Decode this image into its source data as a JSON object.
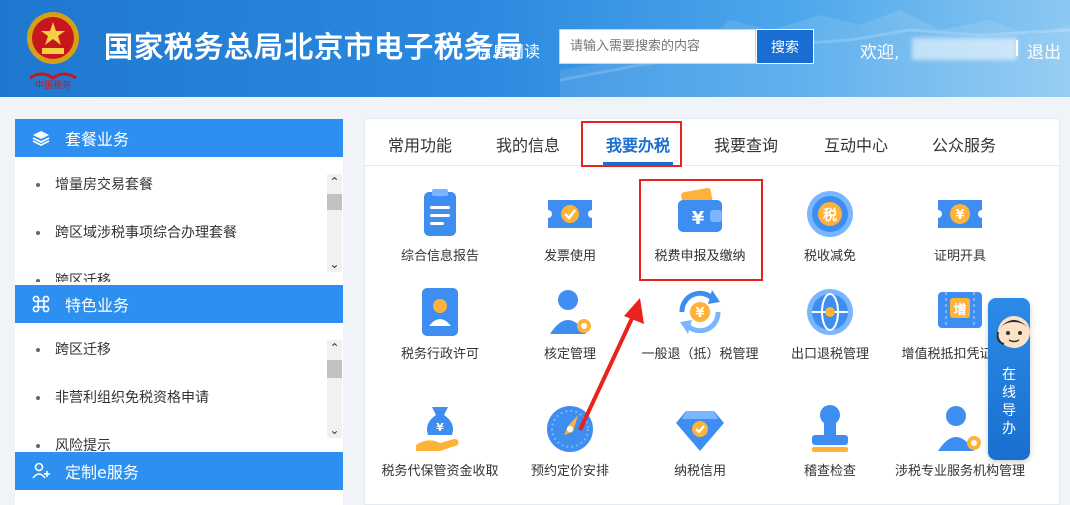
{
  "header": {
    "title": "国家税务总局北京市电子税务局",
    "reader_link": "信息阅读",
    "search_placeholder": "请输入需要搜索的内容",
    "search_button": "搜索",
    "welcome": "欢迎,",
    "logout": "退出"
  },
  "sidebar": {
    "sections": [
      {
        "title": "套餐业务",
        "icon": "layers-icon",
        "items": [
          "增量房交易套餐",
          "跨区域涉税事项综合办理套餐",
          "跨区迁移"
        ]
      },
      {
        "title": "特色业务",
        "icon": "command-icon",
        "items": [
          "跨区迁移",
          "非营利组织免税资格申请",
          "风险提示"
        ]
      },
      {
        "title": "定制e服务",
        "icon": "user-plus-icon",
        "items": []
      }
    ]
  },
  "tabs": [
    "常用功能",
    "我的信息",
    "我要办税",
    "我要查询",
    "互动中心",
    "公众服务"
  ],
  "active_tab": "我要办税",
  "functions": [
    {
      "label": "综合信息报告",
      "icon": "clipboard-icon"
    },
    {
      "label": "发票使用",
      "icon": "ticket-check-icon"
    },
    {
      "label": "税费申报及缴纳",
      "icon": "wallet-yuan-icon"
    },
    {
      "label": "税收减免",
      "icon": "tax-coin-icon"
    },
    {
      "label": "证明开具",
      "icon": "certificate-yuan-icon"
    },
    {
      "label": "税务行政许可",
      "icon": "id-card-icon"
    },
    {
      "label": "核定管理",
      "icon": "user-gear-icon"
    },
    {
      "label": "一般退（抵）税管理",
      "icon": "yuan-refresh-icon"
    },
    {
      "label": "出口退税管理",
      "icon": "globe-icon"
    },
    {
      "label": "增值税抵扣凭证管理",
      "icon": "vat-ticket-icon"
    },
    {
      "label": "税务代保管资金收取",
      "icon": "money-bag-hand-icon"
    },
    {
      "label": "预约定价安排",
      "icon": "compass-icon"
    },
    {
      "label": "纳税信用",
      "icon": "diamond-check-icon"
    },
    {
      "label": "稽查检查",
      "icon": "stamp-icon"
    },
    {
      "label": "涉税专业服务机构管理",
      "icon": "person-gear-icon"
    }
  ],
  "guide": {
    "text": "在线导办",
    "icon": "support-agent-icon"
  },
  "colors": {
    "primary": "#1b6ed1",
    "accent_red": "#e8231d",
    "sidebar_header": "#2d8ff0"
  }
}
